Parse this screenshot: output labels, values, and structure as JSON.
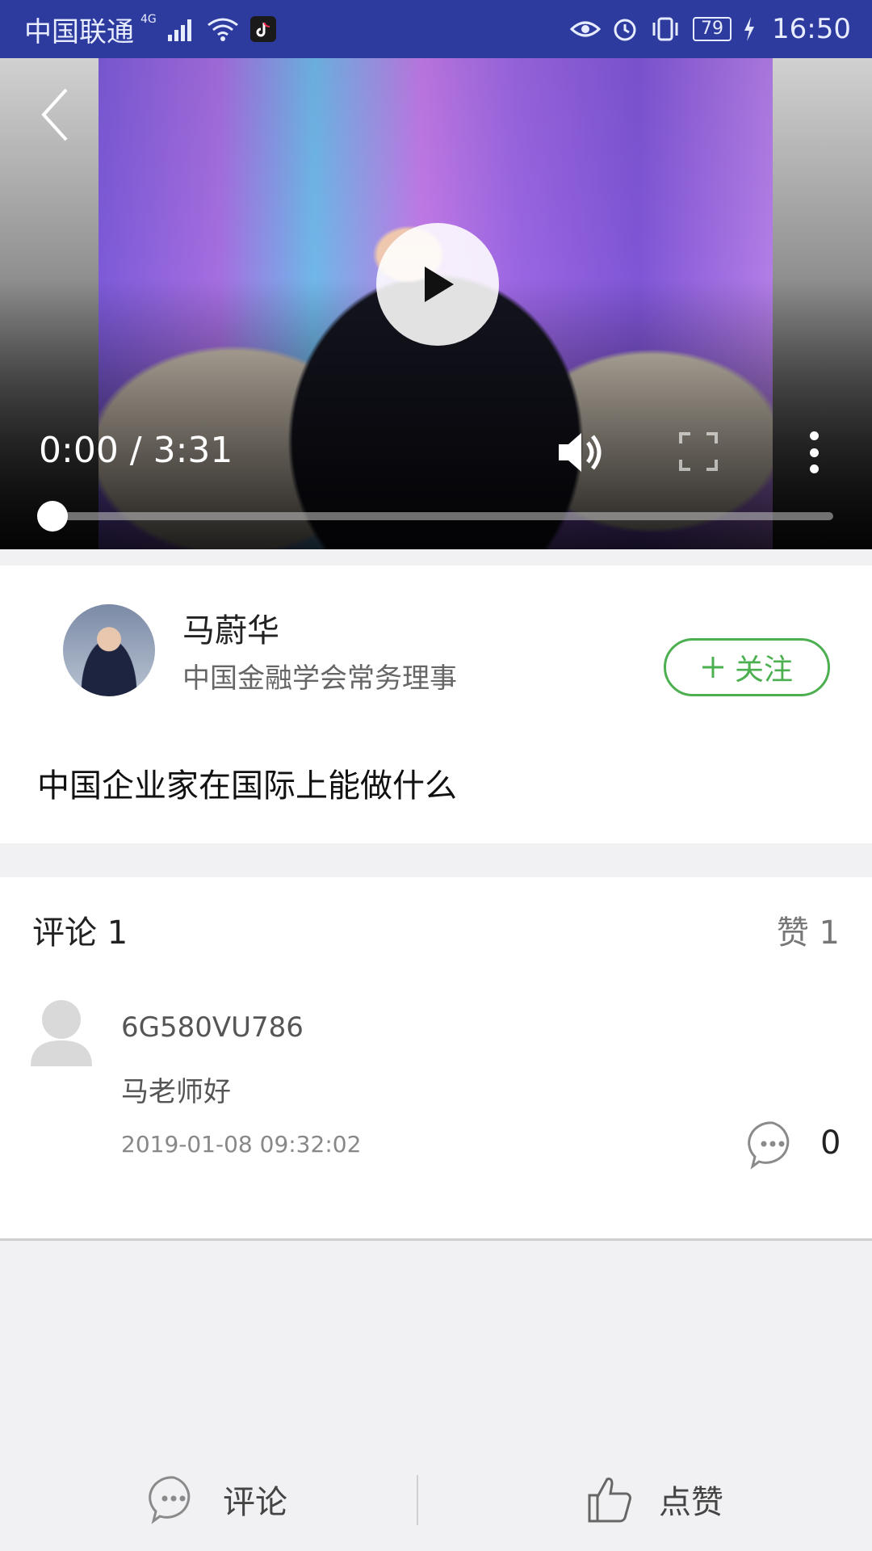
{
  "status_bar": {
    "carrier": "中国联通",
    "network": "4G",
    "battery": "79",
    "time": "16:50"
  },
  "video": {
    "time_label": "0:00 / 3:31",
    "progress": 0.0
  },
  "author": {
    "name": "马蔚华",
    "title": "中国金融学会常务理事",
    "follow_label": "关注"
  },
  "video_title": "中国企业家在国际上能做什么",
  "comments_section": {
    "comments_label": "评论 1",
    "likes_label": "赞 1",
    "items": [
      {
        "user": "6G580VU786",
        "text": "马老师好",
        "time": "2019-01-08 09:32:02",
        "reply_count": "0"
      }
    ]
  },
  "bottom_bar": {
    "comment_label": "评论",
    "like_label": "点赞"
  },
  "colors": {
    "status_bar": "#2d3a9e",
    "accent_green": "#4caf50"
  }
}
